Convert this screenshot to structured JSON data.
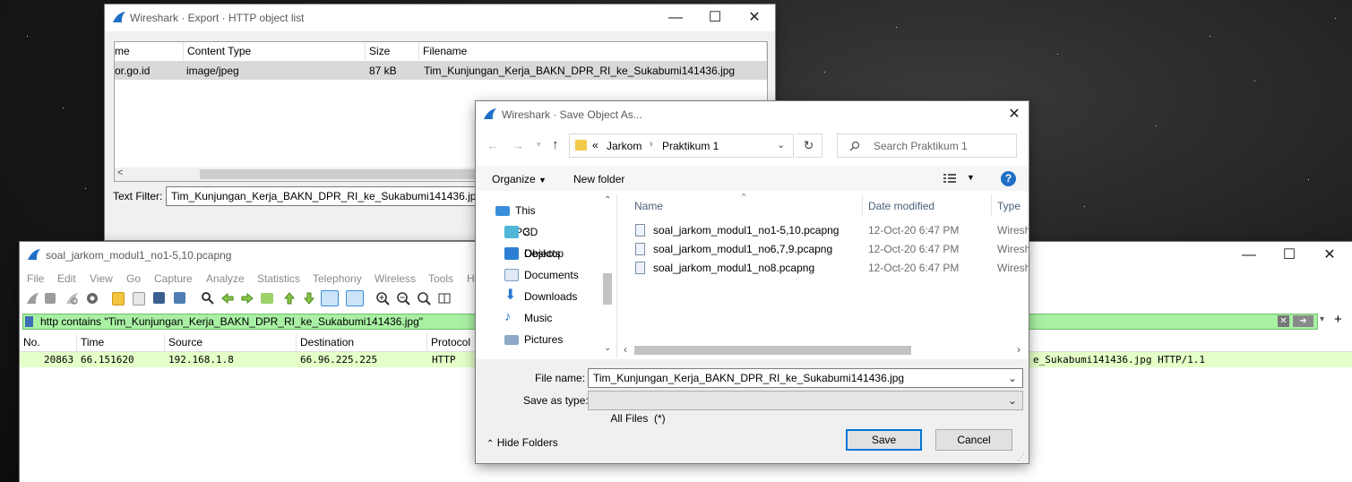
{
  "export_window": {
    "title": "Wireshark · Export · HTTP object list",
    "columns": [
      "me",
      "Content Type",
      "Size",
      "Filename"
    ],
    "rows": [
      {
        "hostname": "or.go.id",
        "content_type": "image/jpeg",
        "size": "87 kB",
        "filename": "Tim_Kunjungan_Kerja_BAKN_DPR_RI_ke_Sukabumi141436.jpg"
      }
    ],
    "text_filter_label": "Text Filter:",
    "text_filter_value": "Tim_Kunjungan_Kerja_BAKN_DPR_RI_ke_Sukabumi141436.jpg"
  },
  "main_window": {
    "title": "soal_jarkom_modul1_no1-5,10.pcapng",
    "menu": [
      "File",
      "Edit",
      "View",
      "Go",
      "Capture",
      "Analyze",
      "Statistics",
      "Telephony",
      "Wireless",
      "Tools",
      "H"
    ],
    "filter_value": "http contains \"Tim_Kunjungan_Kerja_BAKN_DPR_RI_ke_Sukabumi141436.jpg\"",
    "filter_add": "+",
    "columns": [
      "No.",
      "Time",
      "Source",
      "Destination",
      "Protocol"
    ],
    "packets": [
      {
        "no": "20863",
        "time": "66.151620",
        "source": "192.168.1.8",
        "destination": "66.96.225.225",
        "protocol": "HTTP",
        "info_tail": "e_Sukabumi141436.jpg HTTP/1.1"
      }
    ]
  },
  "save_dialog": {
    "title": "Wireshark · Save Object As...",
    "breadcrumb": {
      "chevrons": "«",
      "parts": [
        "Jarkom",
        "Praktikum 1"
      ]
    },
    "search_placeholder": "Search Praktikum 1",
    "organize_label": "Organize",
    "new_folder_label": "New folder",
    "help_glyph": "?",
    "tree": [
      {
        "label": "This PC",
        "icon": "pc-icon"
      },
      {
        "label": "3D Objects",
        "icon": "cube-icon"
      },
      {
        "label": "Desktop",
        "icon": "desktop-icon"
      },
      {
        "label": "Documents",
        "icon": "documents-icon"
      },
      {
        "label": "Downloads",
        "icon": "downloads-icon"
      },
      {
        "label": "Music",
        "icon": "music-icon"
      },
      {
        "label": "Pictures",
        "icon": "pictures-icon"
      }
    ],
    "file_columns": [
      "Name",
      "Date modified",
      "Type"
    ],
    "files": [
      {
        "name": "soal_jarkom_modul1_no1-5,10.pcapng",
        "date": "12-Oct-20 6:47 PM",
        "type": "Wiresh"
      },
      {
        "name": "soal_jarkom_modul1_no6,7,9.pcapng",
        "date": "12-Oct-20 6:47 PM",
        "type": "Wiresh"
      },
      {
        "name": "soal_jarkom_modul1_no8.pcapng",
        "date": "12-Oct-20 6:47 PM",
        "type": "Wiresh"
      }
    ],
    "file_name_label": "File name:",
    "file_name_value": "Tim_Kunjungan_Kerja_BAKN_DPR_RI_ke_Sukabumi141436.jpg",
    "save_as_type_label": "Save as type:",
    "save_as_type_value": "All Files  (*)",
    "hide_folders_label": "Hide Folders",
    "save_label": "Save",
    "cancel_label": "Cancel"
  },
  "colors": {
    "filter_green": "#a9f0a4",
    "packet_row_green": "#e4ffc7",
    "accent_blue": "#0078d7",
    "fin_blue": "#1f6fc5"
  }
}
